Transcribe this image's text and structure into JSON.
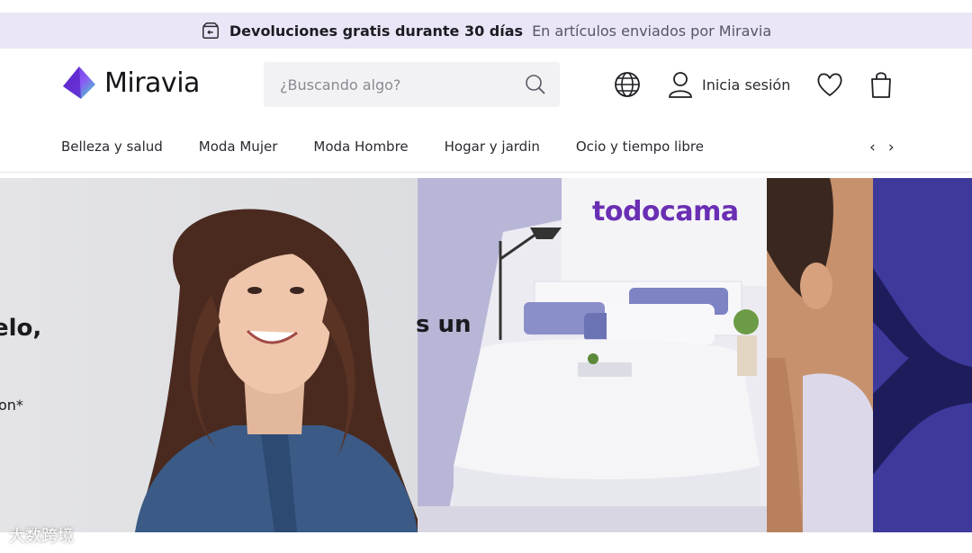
{
  "promo": {
    "title": "Devoluciones gratis durante 30 días",
    "subtitle": "En artículos enviados por Miravia",
    "icon": "return-box-icon"
  },
  "header": {
    "logo_text": "Miravia",
    "search": {
      "placeholder": "¿Buscando algo?"
    },
    "signin_label": "Inicia sesión",
    "icons": [
      "globe-icon",
      "user-icon",
      "heart-icon",
      "bag-icon"
    ]
  },
  "categories": [
    "Belleza y salud",
    "Moda Mujer",
    "Moda Hombre",
    "Hogar y jardin",
    "Ocio y tiempo libre"
  ],
  "carousel": {
    "slide1": {
      "headline": "elo,\n.",
      "subline": "on*"
    },
    "slide2": {
      "headline": "s un",
      "brand": "todocama"
    }
  },
  "watermark": "大数跨境",
  "colors": {
    "promo_bg": "#ebe6f7",
    "brand_purple": "#6a2fb3",
    "accent_indigo": "#3e3a9c",
    "logo_gradient_start": "#7b3ff2",
    "logo_gradient_end": "#3de0c0"
  }
}
